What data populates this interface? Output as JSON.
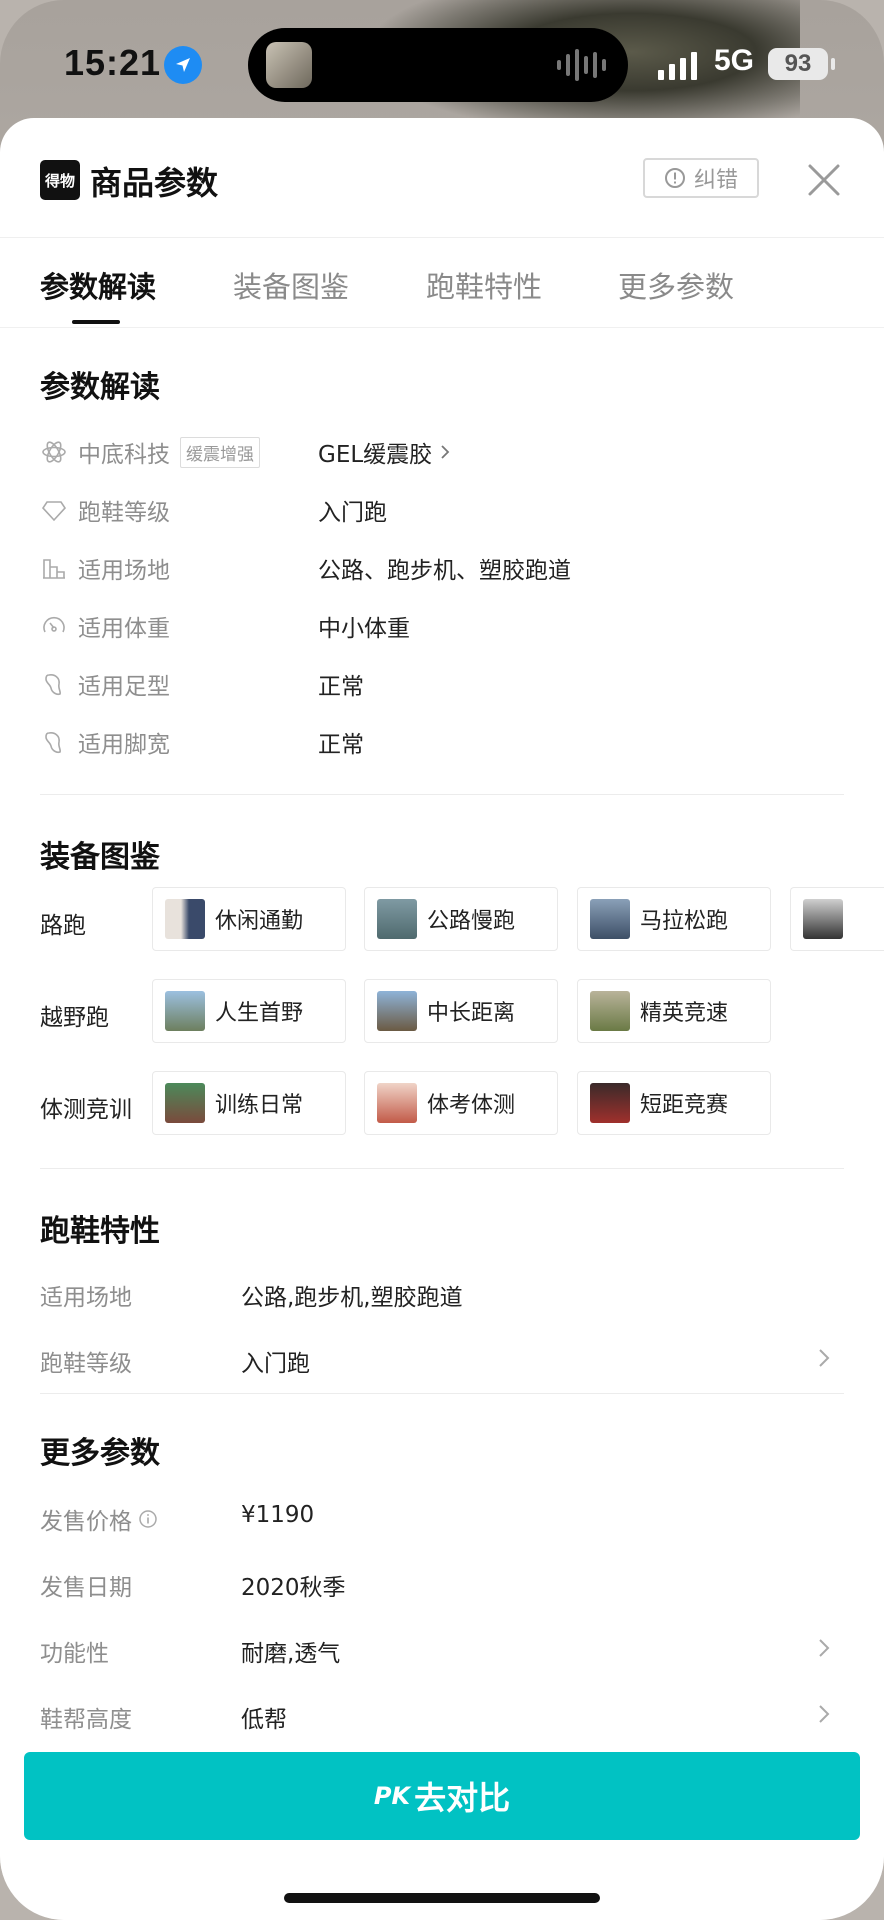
{
  "status_bar": {
    "time": "15:21",
    "network": "5G",
    "battery": "93"
  },
  "header": {
    "logo_text": "得物",
    "title": "商品参数",
    "correct_label": "纠错"
  },
  "tabs": [
    {
      "label": "参数解读",
      "active": true
    },
    {
      "label": "装备图鉴",
      "active": false
    },
    {
      "label": "跑鞋特性",
      "active": false
    },
    {
      "label": "更多参数",
      "active": false
    }
  ],
  "param_section": {
    "title": "参数解读",
    "rows": [
      {
        "icon": "atom-icon",
        "label": "中底科技",
        "tag": "缓震增强",
        "value": "GEL缓震胶"
      },
      {
        "icon": "diamond-icon",
        "label": "跑鞋等级",
        "value": "入门跑"
      },
      {
        "icon": "venue-icon",
        "label": "适用场地",
        "value": "公路、跑步机、塑胶跑道"
      },
      {
        "icon": "gauge-icon",
        "label": "适用体重",
        "value": "中小体重"
      },
      {
        "icon": "foot-icon",
        "label": "适用足型",
        "value": "正常"
      },
      {
        "icon": "foot-icon",
        "label": "适用脚宽",
        "value": "正常"
      }
    ]
  },
  "gear_section": {
    "title": "装备图鉴",
    "groups": [
      {
        "label": "路跑",
        "items": [
          "休闲通勤",
          "公路慢跑",
          "马拉松跑"
        ]
      },
      {
        "label": "越野跑",
        "items": [
          "人生首野",
          "中长距离",
          "精英竞速"
        ]
      },
      {
        "label": "体测竞训",
        "items": [
          "训练日常",
          "体考体测",
          "短距竞赛"
        ]
      }
    ]
  },
  "traits_section": {
    "title": "跑鞋特性",
    "rows": [
      {
        "label": "适用场地",
        "value": "公路,跑步机,塑胶跑道"
      },
      {
        "label": "跑鞋等级",
        "value": "入门跑"
      }
    ]
  },
  "more_section": {
    "title": "更多参数",
    "rows": [
      {
        "label": "发售价格",
        "value": "¥1190"
      },
      {
        "label": "发售日期",
        "value": "2020秋季"
      },
      {
        "label": "功能性",
        "value": "耐磨,透气"
      },
      {
        "label": "鞋帮高度",
        "value": "低帮"
      }
    ]
  },
  "cta": {
    "badge": "PK",
    "label": "去对比",
    "color": "#01c2c3"
  }
}
